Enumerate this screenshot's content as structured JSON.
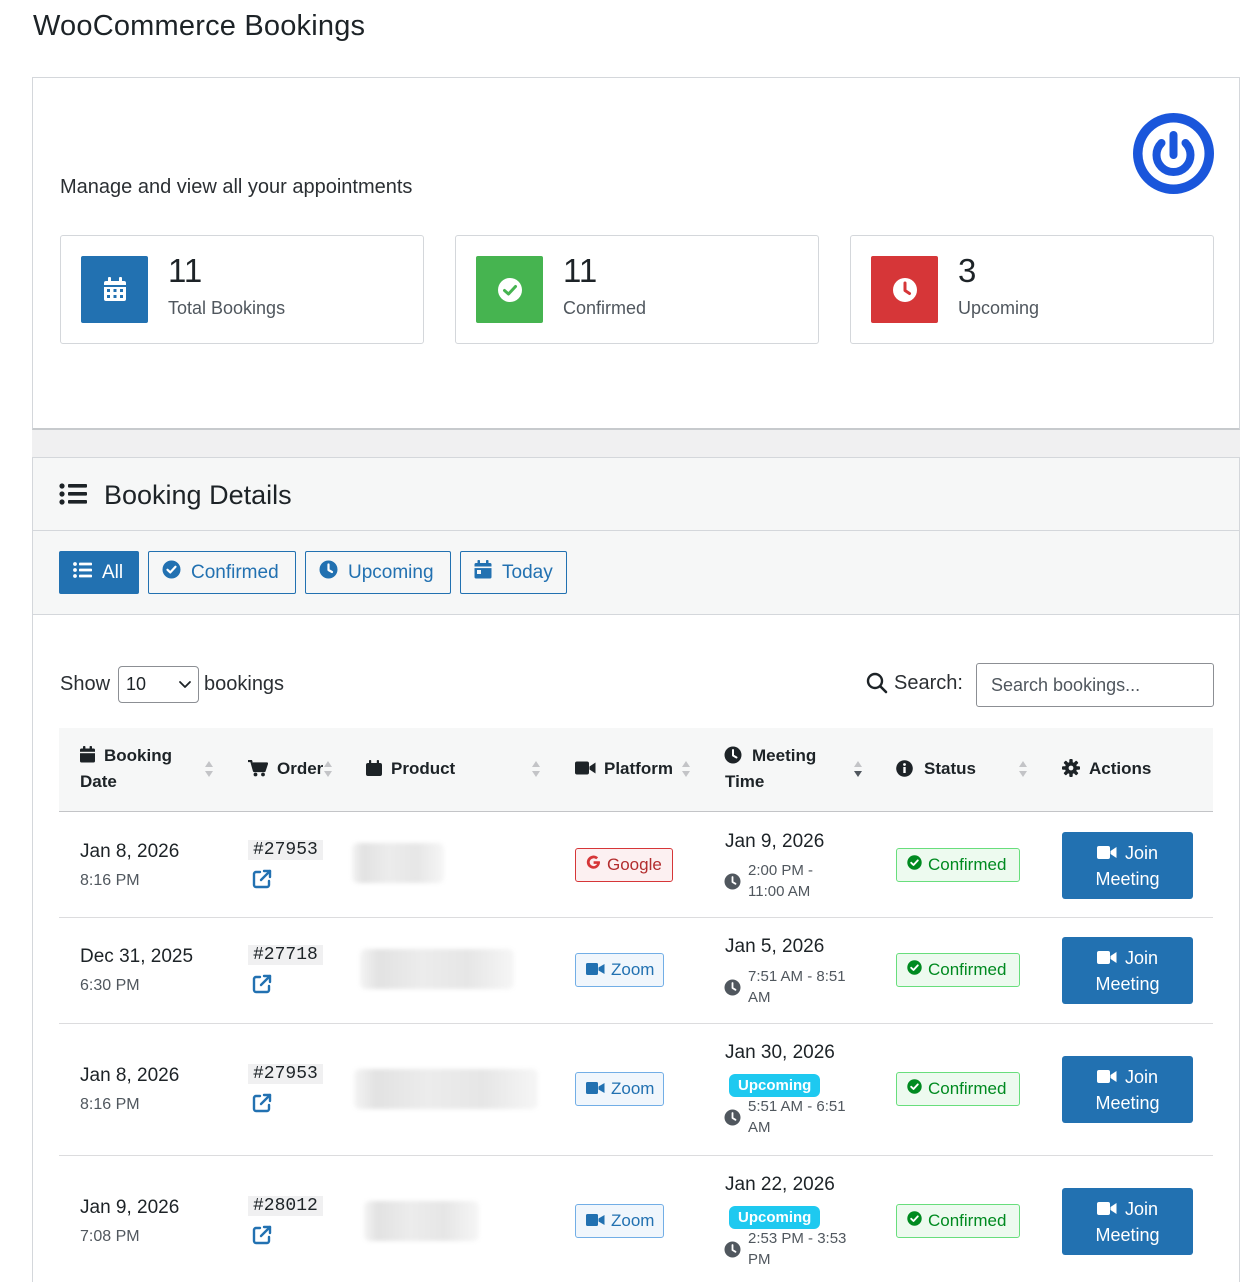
{
  "page": {
    "title": "WooCommerce Bookings"
  },
  "hero": {
    "subtitle": "Manage and view all your appointments",
    "brand_color": "#1a56db",
    "stats": [
      {
        "number": "11",
        "label": "Total Bookings",
        "icon": "calendar-icon",
        "color": "#2271b1"
      },
      {
        "number": "11",
        "label": "Confirmed",
        "icon": "check-circle-icon",
        "color": "#46b450"
      },
      {
        "number": "3",
        "label": "Upcoming",
        "icon": "clock-icon",
        "color": "#d63638"
      }
    ]
  },
  "details": {
    "title": "Booking Details",
    "filters": [
      {
        "label": "All",
        "icon": "list-icon",
        "active": true
      },
      {
        "label": "Confirmed",
        "icon": "check-circle-icon",
        "active": false
      },
      {
        "label": "Upcoming",
        "icon": "clock-icon",
        "active": false
      },
      {
        "label": "Today",
        "icon": "calendar-icon",
        "active": false
      }
    ],
    "show_label": "Show",
    "show_value": "10",
    "show_suffix": "bookings",
    "search_label": "Search:",
    "search_placeholder": "Search bookings...",
    "columns": {
      "booking_date_1": "Booking",
      "booking_date_2": "Date",
      "order": "Order",
      "product": "Product",
      "platform": "Platform",
      "meeting_time_1": "Meeting",
      "meeting_time_2": "Time",
      "status": "Status",
      "actions": "Actions"
    },
    "rows": [
      {
        "date": "Jan 8, 2026",
        "time": "8:16 PM",
        "order": "#27953",
        "platform": "Google",
        "platform_icon": "google-icon",
        "meeting_date": "Jan 9, 2026",
        "meeting_badge": "",
        "meeting_range_1": "2:00 PM -",
        "meeting_range_2": "11:00 AM",
        "status": "Confirmed",
        "action_1": "Join",
        "action_2": "Meeting"
      },
      {
        "date": "Dec 31, 2025",
        "time": "6:30 PM",
        "order": "#27718",
        "platform": "Zoom",
        "platform_icon": "video-icon",
        "meeting_date": "Jan 5, 2026",
        "meeting_badge": "",
        "meeting_range_1": "7:51 AM - 8:51",
        "meeting_range_2": "AM",
        "status": "Confirmed",
        "action_1": "Join",
        "action_2": "Meeting"
      },
      {
        "date": "Jan 8, 2026",
        "time": "8:16 PM",
        "order": "#27953",
        "platform": "Zoom",
        "platform_icon": "video-icon",
        "meeting_date": "Jan 30, 2026",
        "meeting_badge": "Upcoming",
        "meeting_range_1": "5:51 AM - 6:51",
        "meeting_range_2": "AM",
        "status": "Confirmed",
        "action_1": "Join",
        "action_2": "Meeting"
      },
      {
        "date": "Jan 9, 2026",
        "time": "7:08 PM",
        "order": "#28012",
        "platform": "Zoom",
        "platform_icon": "video-icon",
        "meeting_date": "Jan 22, 2026",
        "meeting_badge": "Upcoming",
        "meeting_range_1": "2:53 PM - 3:53",
        "meeting_range_2": "PM",
        "status": "Confirmed",
        "action_1": "Join",
        "action_2": "Meeting"
      }
    ]
  }
}
